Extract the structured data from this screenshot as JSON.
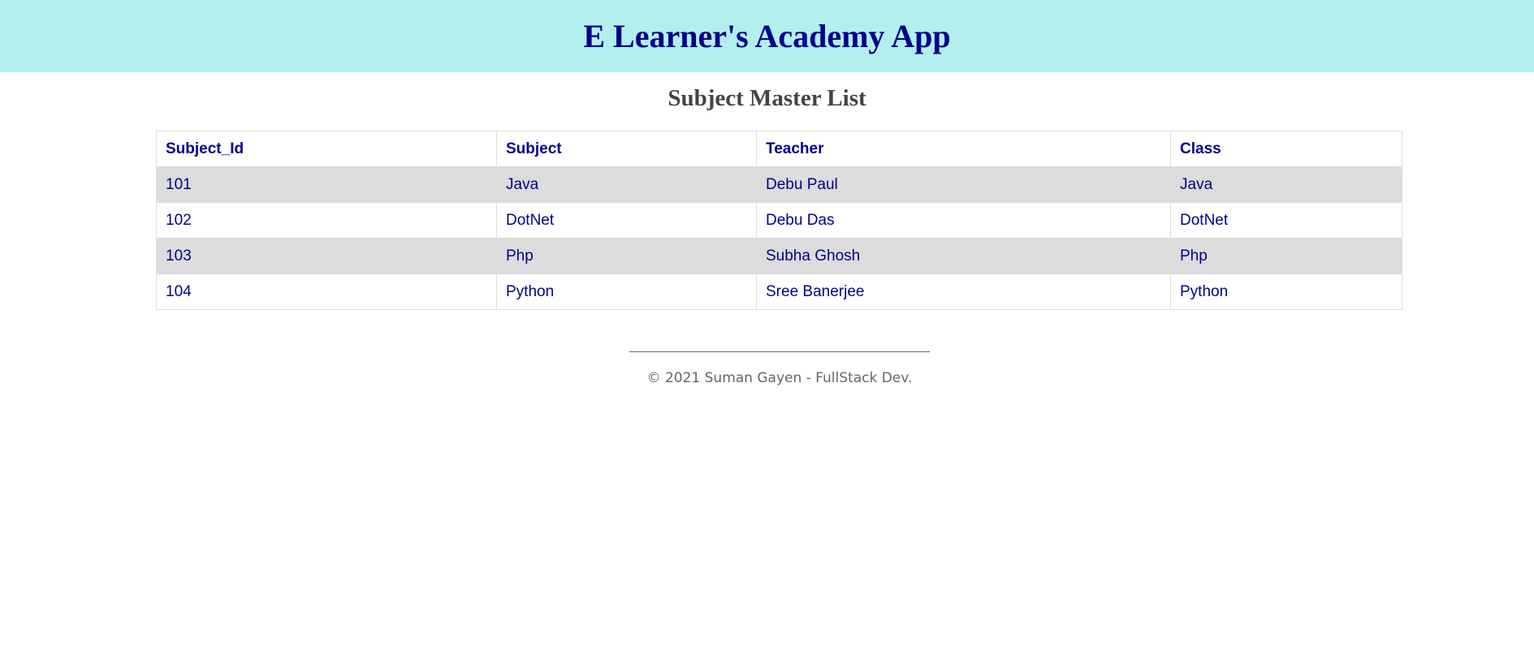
{
  "header": {
    "title": "E Learner's Academy App"
  },
  "page": {
    "title": "Subject Master List"
  },
  "table": {
    "columns": [
      "Subject_Id",
      "Subject",
      "Teacher",
      "Class"
    ],
    "rows": [
      [
        "101",
        "Java",
        "Debu Paul",
        "Java"
      ],
      [
        "102",
        "DotNet",
        "Debu Das",
        "DotNet"
      ],
      [
        "103",
        "Php",
        "Subha Ghosh",
        "Php"
      ],
      [
        "104",
        "Python",
        "Sree Banerjee",
        "Python"
      ]
    ]
  },
  "footer": {
    "text": "© 2021 Suman Gayen - FullStack Dev."
  }
}
